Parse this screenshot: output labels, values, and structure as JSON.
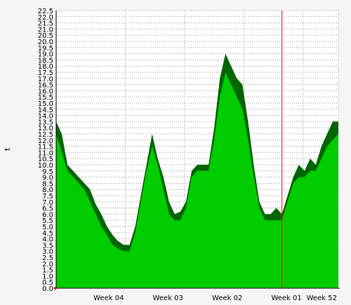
{
  "chart_data": {
    "type": "area",
    "title": "",
    "xlabel": "",
    "ylabel": "t",
    "ylim": [
      0,
      22.5
    ],
    "ytick_step": 0.5,
    "y_tick_labels": [
      "0.0",
      "0.5",
      "1.0",
      "1.5",
      "2.0",
      "2.5",
      "3.0",
      "3.5",
      "4.0",
      "4.5",
      "5.0",
      "5.5",
      "6.0",
      "6.5",
      "7.0",
      "7.5",
      "8.0",
      "8.5",
      "9.0",
      "9.5",
      "10.0",
      "10.5",
      "11.0",
      "11.5",
      "12.0",
      "12.5",
      "13.0",
      "13.5",
      "14.0",
      "14.5",
      "15.0",
      "15.5",
      "16.0",
      "16.5",
      "17.0",
      "17.5",
      "18.0",
      "18.5",
      "19.0",
      "19.5",
      "20.0",
      "20.5",
      "21.0",
      "21.5",
      "22.0",
      "22.5"
    ],
    "x_ticks": [
      {
        "label": "Week 04",
        "x": 0.245
      },
      {
        "label": "Week 03",
        "x": 0.455
      },
      {
        "label": "Week 02",
        "x": 0.665
      },
      {
        "label": "Week 01",
        "x": 0.875
      },
      {
        "label": "Week 52",
        "x": 1.0
      }
    ],
    "current_time_marker": 0.8,
    "grid": true,
    "colors": {
      "background": "#f5f5f5",
      "plot_background": "#ffffff",
      "grid": "#999999",
      "inner_area": "#00cc00",
      "outer_area": "#006600",
      "marker": "#ff0000",
      "axis": "#000000"
    },
    "series": [
      {
        "name": "",
        "role": "max",
        "x": [
          0.0,
          0.02,
          0.04,
          0.06,
          0.08,
          0.1,
          0.12,
          0.14,
          0.16,
          0.18,
          0.2,
          0.22,
          0.24,
          0.26,
          0.28,
          0.3,
          0.32,
          0.34,
          0.36,
          0.38,
          0.4,
          0.42,
          0.44,
          0.46,
          0.48,
          0.5,
          0.52,
          0.54,
          0.56,
          0.58,
          0.6,
          0.62,
          0.64,
          0.66,
          0.68,
          0.7,
          0.72,
          0.74,
          0.76,
          0.78,
          0.8,
          0.82,
          0.84,
          0.86,
          0.88,
          0.9,
          0.92,
          0.94,
          0.96,
          0.98,
          1.0
        ],
        "y": [
          13.5,
          12.5,
          10.0,
          9.5,
          9.0,
          8.5,
          8.0,
          6.8,
          6.0,
          5.0,
          4.3,
          3.8,
          3.5,
          3.5,
          5.0,
          7.5,
          10.0,
          12.5,
          10.5,
          9.0,
          7.0,
          6.0,
          6.2,
          7.0,
          9.5,
          10.0,
          10.0,
          10.0,
          13.0,
          17.0,
          19.0,
          18.0,
          17.0,
          16.5,
          13.5,
          10.0,
          7.0,
          6.0,
          6.0,
          6.5,
          6.0,
          7.5,
          9.0,
          10.0,
          9.5,
          10.5,
          10.0,
          11.5,
          12.5,
          13.5,
          13.5
        ]
      },
      {
        "name": "",
        "role": "avg",
        "x": [
          0.0,
          0.02,
          0.04,
          0.06,
          0.08,
          0.1,
          0.12,
          0.14,
          0.16,
          0.18,
          0.2,
          0.22,
          0.24,
          0.26,
          0.28,
          0.3,
          0.32,
          0.34,
          0.36,
          0.38,
          0.4,
          0.42,
          0.44,
          0.46,
          0.48,
          0.5,
          0.52,
          0.54,
          0.56,
          0.58,
          0.6,
          0.62,
          0.64,
          0.66,
          0.68,
          0.7,
          0.72,
          0.74,
          0.76,
          0.78,
          0.8,
          0.82,
          0.84,
          0.86,
          0.88,
          0.9,
          0.92,
          0.94,
          0.96,
          0.98,
          1.0
        ],
        "y": [
          12.5,
          11.0,
          9.5,
          9.0,
          8.5,
          8.0,
          7.0,
          6.0,
          5.0,
          4.3,
          3.5,
          3.2,
          3.0,
          3.0,
          4.5,
          7.0,
          9.5,
          11.5,
          10.0,
          8.0,
          6.0,
          5.5,
          5.5,
          6.5,
          9.0,
          9.5,
          9.5,
          9.5,
          12.0,
          15.5,
          17.5,
          16.5,
          15.5,
          14.5,
          12.0,
          9.0,
          6.5,
          5.5,
          5.5,
          5.5,
          5.5,
          7.0,
          8.5,
          9.0,
          9.0,
          9.5,
          9.5,
          10.5,
          11.5,
          12.0,
          12.5
        ]
      }
    ]
  }
}
